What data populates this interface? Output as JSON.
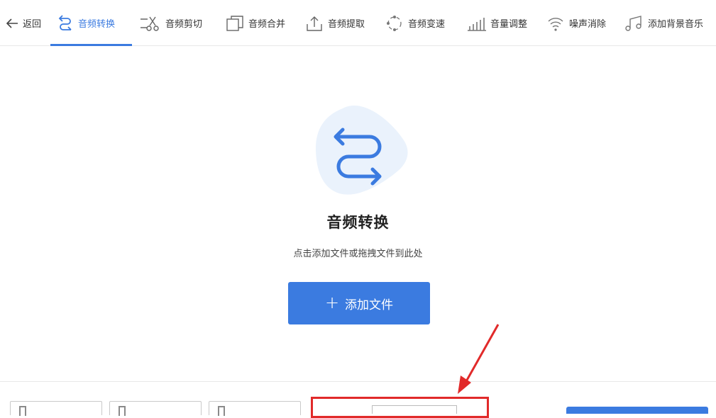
{
  "toolbar": {
    "back_label": "返回",
    "items": [
      {
        "label": "音频转换",
        "icon": "convert-arrows-icon",
        "active": true
      },
      {
        "label": "音频剪切",
        "icon": "scissors-icon",
        "active": false
      },
      {
        "label": "音频合并",
        "icon": "merge-squares-icon",
        "active": false
      },
      {
        "label": "音频提取",
        "icon": "upload-tray-icon",
        "active": false
      },
      {
        "label": "音频变速",
        "icon": "speed-dots-icon",
        "active": false
      },
      {
        "label": "音量调整",
        "icon": "volume-bars-icon",
        "active": false
      },
      {
        "label": "噪声消除",
        "icon": "wifi-noise-icon",
        "active": false
      },
      {
        "label": "添加背景音乐",
        "icon": "music-note-icon",
        "active": false
      }
    ]
  },
  "main": {
    "title": "音频转换",
    "subtitle": "点击添加文件或拖拽文件到此处",
    "add_button_label": "添加文件",
    "add_button_symbol": "+"
  },
  "colors": {
    "accent": "#3b7be0",
    "icon_bg": "#eaf2fc",
    "highlight": "#e12a2a"
  }
}
